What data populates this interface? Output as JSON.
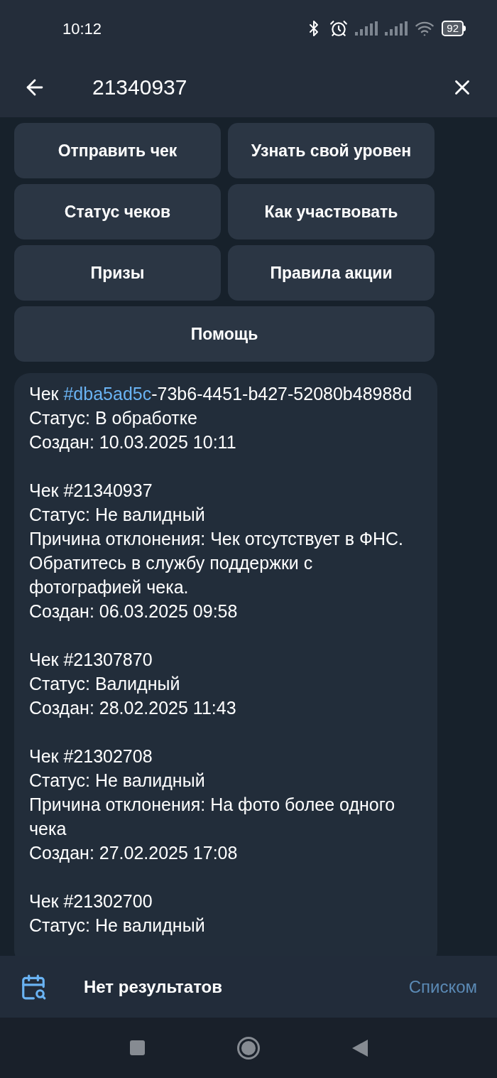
{
  "status_bar": {
    "time": "10:12",
    "battery": "92"
  },
  "header": {
    "query": "21340937"
  },
  "keyboard": [
    [
      "Отправить чек",
      "Узнать свой уровен"
    ],
    [
      "Статус чеков",
      "Как участвовать"
    ],
    [
      "Призы",
      "Правила акции"
    ],
    [
      "Помощь"
    ]
  ],
  "message": {
    "blocks": [
      {
        "first_line": {
          "prefix": "Чек ",
          "tag": "#dba5ad5c",
          "rest": "-73b6-4451-b427-52080b48988d"
        },
        "lines": [
          "Статус: В обработке",
          "Создан: 10.03.2025 10:11"
        ]
      },
      {
        "first_line": {
          "prefix": "Чек #21340937"
        },
        "lines": [
          "Статус: Не валидный",
          "Причина отклонения: Чек отсутствует в ФНС. Обратитесь в службу поддержки с фотографией чека.",
          "Создан: 06.03.2025 09:58"
        ]
      },
      {
        "first_line": {
          "prefix": "Чек #21307870"
        },
        "lines": [
          "Статус: Валидный",
          "Создан: 28.02.2025 11:43"
        ]
      },
      {
        "first_line": {
          "prefix": "Чек #21302708"
        },
        "lines": [
          "Статус: Не валидный",
          "Причина отклонения: На фото более одного чека",
          "Создан: 27.02.2025 17:08"
        ]
      },
      {
        "first_line": {
          "prefix": "Чек #21302700"
        },
        "lines": [
          "Статус: Не валидный"
        ]
      }
    ]
  },
  "search_bar": {
    "result": "Нет результатов",
    "view_button": "Списком"
  }
}
